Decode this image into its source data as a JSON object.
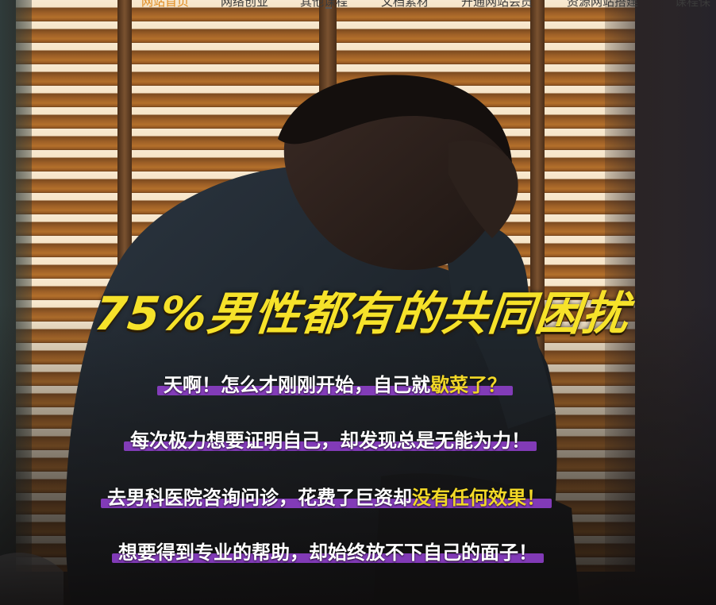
{
  "nav": {
    "items": [
      {
        "label": "网站首页",
        "active": true
      },
      {
        "label": "网络创业",
        "active": false
      },
      {
        "label": "其他课程",
        "active": false
      },
      {
        "label": "文档素材",
        "active": false
      },
      {
        "label": "开通网站会员",
        "active": false
      },
      {
        "label": "资源网站搭建",
        "active": false
      },
      {
        "label": "课程保",
        "active": false
      }
    ],
    "active_color": "#e08a1e"
  },
  "banner": {
    "headline": "75%男性都有的共同困扰",
    "headline_color": "#f6e22a",
    "highlight_color": "#f3d927",
    "bar_color": "#8e3fc9",
    "lines": [
      {
        "plain": "天啊！怎么才刚刚开始，自己就",
        "highlight": "歇菜了？"
      },
      {
        "plain": "每次极力想要证明自己，却发现总是无能为力！",
        "highlight": ""
      },
      {
        "plain": "去男科医院咨询问诊，花费了巨资却",
        "highlight": "没有任何效果！"
      },
      {
        "plain": "想要得到专业的帮助，却始终放不下自己的面子！",
        "highlight": ""
      }
    ]
  }
}
